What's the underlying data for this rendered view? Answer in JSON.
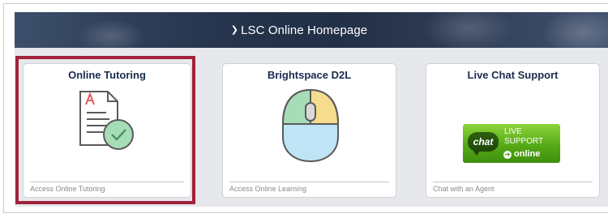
{
  "banner": {
    "chevron_icon": "chevron-down-icon",
    "title": "LSC Online Homepage"
  },
  "tiles": [
    {
      "title": "Online Tutoring",
      "icon": "document-check-icon",
      "caption": "Access Online Tutoring",
      "highlighted": true
    },
    {
      "title": "Brightspace D2L",
      "icon": "mouse-icon",
      "caption": "Access Online Learning"
    },
    {
      "title": "Live Chat Support",
      "icon": "live-chat-badge",
      "caption": "Chat with an Agent",
      "badge": {
        "chat": "chat",
        "line1": "LIVE",
        "line2": "SUPPORT",
        "line3": "online"
      }
    }
  ],
  "colors": {
    "banner_text": "#ffffff",
    "tile_title": "#1b2a4e",
    "highlight_border": "#a0223c",
    "tile_area_bg": "#e6e8eb",
    "badge_green": "#55aa17"
  }
}
